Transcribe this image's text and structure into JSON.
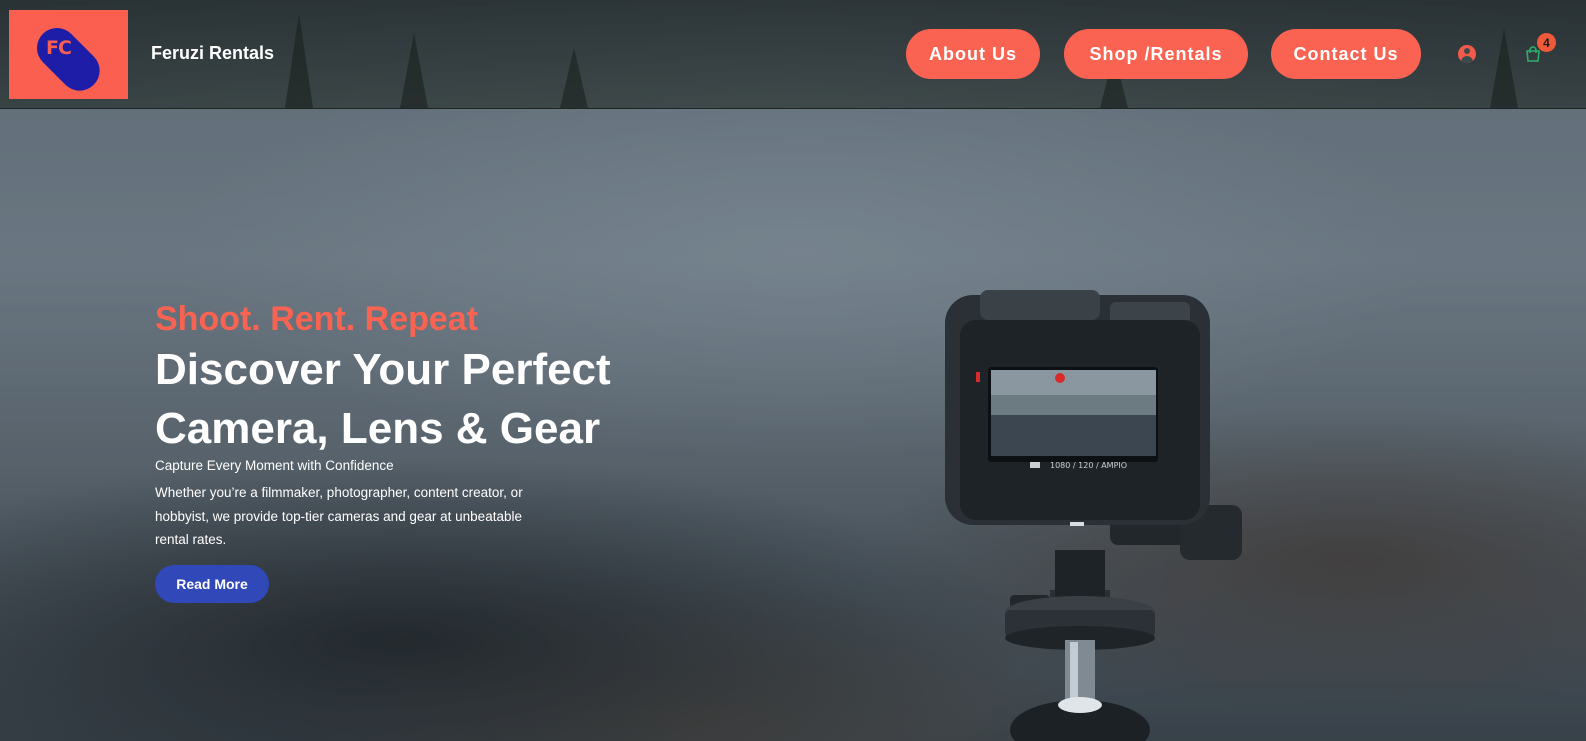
{
  "brand": {
    "logo_text": "FC",
    "name": "Feruzi Rentals"
  },
  "nav": {
    "about_label": "About Us",
    "shop_label": "Shop /Rentals",
    "contact_label": "Contact Us"
  },
  "cart": {
    "count": "4"
  },
  "hero": {
    "tagline": "Shoot. Rent. Repeat",
    "headline": "Discover Your Perfect Camera, Lens & Gear",
    "subhead": "Capture Every Moment with Confidence",
    "description": "Whether you’re a filmmaker, photographer, content creator, or hobbyist, we provide top-tier cameras and gear at unbeatable rental rates.",
    "cta_label": "Read More"
  },
  "camera_screen": {
    "readout": "1080 / 120 / AMPIO"
  },
  "colors": {
    "accent": "#fa6352",
    "cta": "#3148b8",
    "logo_pill": "#1d1da8"
  },
  "icons": {
    "user": "user-icon",
    "cart": "shopping-bag-icon"
  }
}
